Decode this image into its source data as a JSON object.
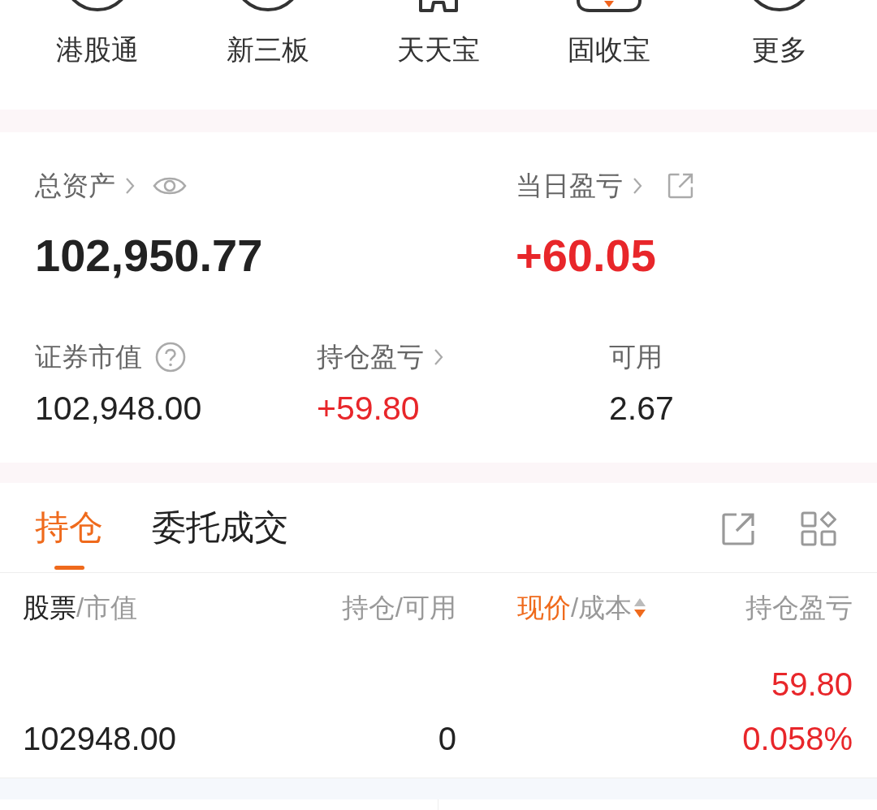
{
  "shortcuts": [
    {
      "label": "港股通",
      "kind": "circle"
    },
    {
      "label": "新三板",
      "kind": "circle"
    },
    {
      "label": "天天宝",
      "kind": "piggy"
    },
    {
      "label": "固收宝",
      "kind": "bowl"
    },
    {
      "label": "更多",
      "kind": "circle"
    }
  ],
  "assets": {
    "total": {
      "label": "总资产",
      "value": "102,950.77"
    },
    "daily_pnl": {
      "label": "当日盈亏",
      "value": "+60.05",
      "positive": true
    },
    "securities_value": {
      "label": "证券市值",
      "value": "102,948.00"
    },
    "position_pnl": {
      "label": "持仓盈亏",
      "value": "+59.80",
      "positive": true
    },
    "available": {
      "label": "可用",
      "value": "2.67"
    }
  },
  "tabs": [
    {
      "label": "持仓",
      "selected": true
    },
    {
      "label": "委托成交",
      "selected": false
    }
  ],
  "table": {
    "columns": [
      {
        "label": "股票",
        "sublabel": "/市值",
        "primary": true,
        "selected": false
      },
      {
        "label": "持仓",
        "sublabel": "/可用",
        "selected": false
      },
      {
        "label": "现价",
        "sublabel": "/成本",
        "selected": true,
        "descending": true
      },
      {
        "label": "持仓盈亏",
        "selected": false
      }
    ],
    "rows": [
      {
        "market_value": "102948.00",
        "available": "0",
        "pnl": "59.80",
        "pnl_percent": "0.058%",
        "positive": true
      }
    ]
  }
}
